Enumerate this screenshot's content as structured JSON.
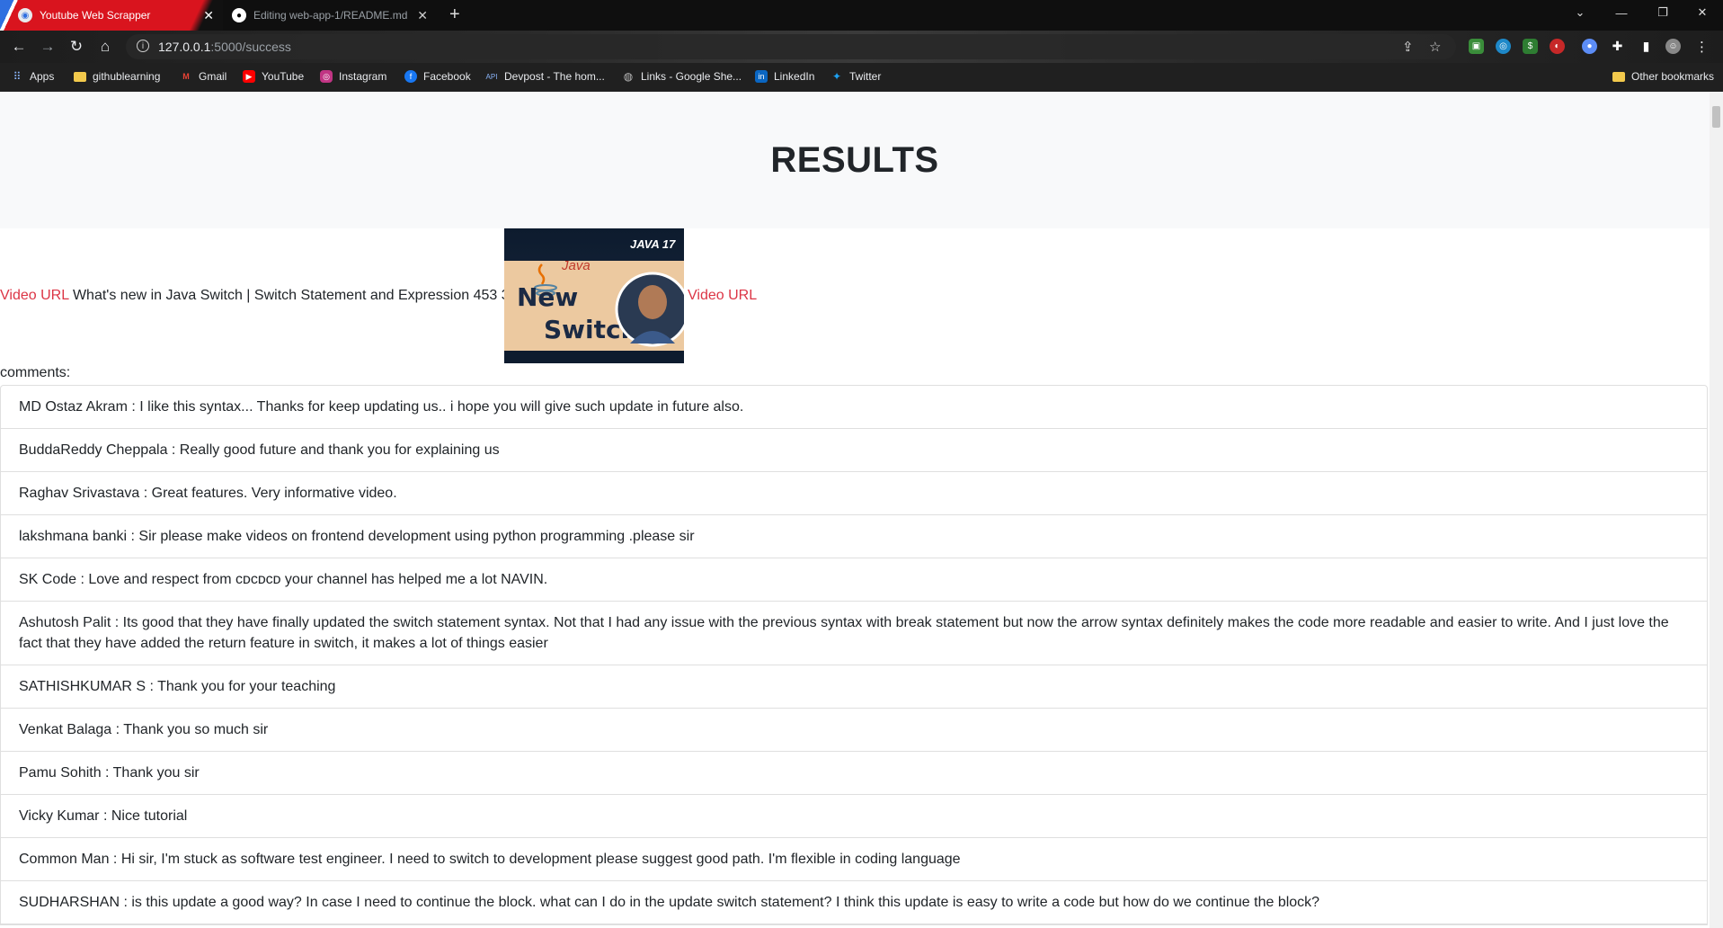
{
  "browser": {
    "tabs": [
      {
        "title": "Youtube Web Scrapper"
      },
      {
        "title": "Editing web-app-1/README.md"
      }
    ],
    "url_host": "127.0.0.1",
    "url_path": ":5000/success",
    "bookmarks": [
      {
        "label": "Apps"
      },
      {
        "label": "githublearning"
      },
      {
        "label": "Gmail"
      },
      {
        "label": "YouTube"
      },
      {
        "label": "Instagram"
      },
      {
        "label": "Facebook"
      },
      {
        "label": "Devpost - The hom..."
      },
      {
        "label": "Links - Google She..."
      },
      {
        "label": "LinkedIn"
      },
      {
        "label": "Twitter"
      }
    ],
    "other_bookmarks": "Other bookmarks"
  },
  "page": {
    "heading": "RESULTS",
    "result": {
      "video_url_label": "Video URL",
      "title": "What's new in Java Switch | Switch Statement and Expression",
      "likes": "453",
      "comment_count": "38",
      "video_url_label_2": "Video URL",
      "thumbnail": {
        "badge": "JAVA 17",
        "logo_text": "Java",
        "line1": "New",
        "line2": "Switch"
      }
    },
    "comments_label": "comments:",
    "comments": [
      {
        "text": "MD Ostaz Akram : I like this syntax... Thanks for keep updating us.. i hope you will give such update in future also."
      },
      {
        "text": "BuddaReddy Cheppala : Really good future and thank you for explaining us"
      },
      {
        "text": "Raghav Srivastava : Great features. Very informative video."
      },
      {
        "text": "lakshmana banki : Sir please make videos on frontend development using python programming .please sir"
      },
      {
        "text": "SK Code : Love and respect from ᴄᴅᴄᴅᴄᴅ your channel has helped me a lot NAVIN."
      },
      {
        "text": "Ashutosh Palit : Its good that they have finally updated the switch statement syntax. Not that I had any issue with the previous syntax with break statement but now the arrow syntax definitely makes the code more readable and easier to write. And I just love the fact that they have added the return feature in switch, it makes a lot of things easier"
      },
      {
        "text": "SATHISHKUMAR S : Thank you for your teaching"
      },
      {
        "text": "Venkat Balaga : Thank you so much sir"
      },
      {
        "text": "Pamu Sohith : Thank you sir"
      },
      {
        "text": "Vicky Kumar : Nice tutorial"
      },
      {
        "text": "Common Man : Hi sir, I'm stuck as software test engineer. I need to switch to development please suggest good path. I'm flexible in coding language"
      },
      {
        "text": "SUDHARSHAN : is this update a good way? In case I need to continue the block. what can I do in the update switch statement? I think this update is easy to write a code but how do we continue the block?"
      }
    ]
  }
}
